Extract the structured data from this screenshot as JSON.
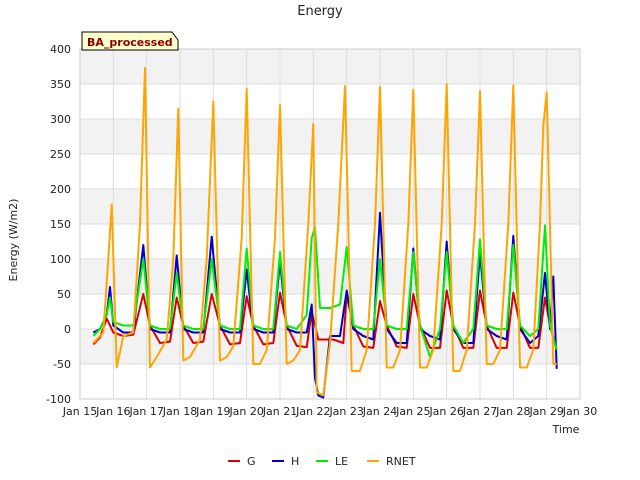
{
  "chart_data": {
    "type": "line",
    "title": "Energy",
    "xlabel": "Time",
    "ylabel": "Energy (W/m2)",
    "badge": "BA_processed",
    "xlim": [
      15,
      30
    ],
    "ylim": [
      -100,
      400
    ],
    "yticks": [
      -100,
      -50,
      0,
      50,
      100,
      150,
      200,
      250,
      300,
      350,
      400
    ],
    "xticks": [
      {
        "v": 15,
        "label": "Jan 15"
      },
      {
        "v": 16,
        "label": "Jan 16"
      },
      {
        "v": 17,
        "label": "Jan 17"
      },
      {
        "v": 18,
        "label": "Jan 18"
      },
      {
        "v": 19,
        "label": "Jan 19"
      },
      {
        "v": 20,
        "label": "Jan 20"
      },
      {
        "v": 21,
        "label": "Jan 21"
      },
      {
        "v": 22,
        "label": "Jan 22"
      },
      {
        "v": 23,
        "label": "Jan 23"
      },
      {
        "v": 24,
        "label": "Jan 24"
      },
      {
        "v": 25,
        "label": "Jan 25"
      },
      {
        "v": 26,
        "label": "Jan 26"
      },
      {
        "v": 27,
        "label": "Jan 27"
      },
      {
        "v": 28,
        "label": "Jan 28"
      },
      {
        "v": 29,
        "label": "Jan 29"
      },
      {
        "v": 30,
        "label": "Jan 30"
      }
    ],
    "grid": true,
    "legend_position": "bottom",
    "x_units": "day of January (fractional)",
    "series": [
      {
        "name": "G",
        "color": "#dd0000",
        "points": [
          [
            15.4,
            -22
          ],
          [
            15.6,
            -12
          ],
          [
            15.8,
            15
          ],
          [
            16.0,
            -5
          ],
          [
            16.3,
            -10
          ],
          [
            16.6,
            -8
          ],
          [
            16.9,
            50
          ],
          [
            17.1,
            5
          ],
          [
            17.4,
            -20
          ],
          [
            17.7,
            -18
          ],
          [
            17.9,
            45
          ],
          [
            18.1,
            5
          ],
          [
            18.4,
            -20
          ],
          [
            18.7,
            -18
          ],
          [
            18.95,
            50
          ],
          [
            19.2,
            5
          ],
          [
            19.5,
            -22
          ],
          [
            19.8,
            -20
          ],
          [
            20.0,
            47
          ],
          [
            20.2,
            5
          ],
          [
            20.5,
            -22
          ],
          [
            20.8,
            -20
          ],
          [
            21.0,
            52
          ],
          [
            21.2,
            5
          ],
          [
            21.5,
            -24
          ],
          [
            21.8,
            -26
          ],
          [
            21.95,
            25
          ],
          [
            22.15,
            -15
          ],
          [
            22.4,
            -15
          ],
          [
            22.6,
            -15
          ],
          [
            22.9,
            -20
          ],
          [
            23.0,
            48
          ],
          [
            23.2,
            5
          ],
          [
            23.5,
            -25
          ],
          [
            23.8,
            -27
          ],
          [
            24.0,
            40
          ],
          [
            24.2,
            5
          ],
          [
            24.5,
            -25
          ],
          [
            24.8,
            -27
          ],
          [
            25.0,
            50
          ],
          [
            25.2,
            5
          ],
          [
            25.5,
            -27
          ],
          [
            25.8,
            -27
          ],
          [
            26.0,
            55
          ],
          [
            26.2,
            5
          ],
          [
            26.5,
            -27
          ],
          [
            26.8,
            -27
          ],
          [
            27.0,
            55
          ],
          [
            27.2,
            5
          ],
          [
            27.5,
            -27
          ],
          [
            27.8,
            -27
          ],
          [
            28.0,
            52
          ],
          [
            28.2,
            5
          ],
          [
            28.5,
            -27
          ],
          [
            28.75,
            -27
          ],
          [
            28.95,
            45
          ],
          [
            29.1,
            5
          ],
          [
            29.3,
            -30
          ]
        ]
      },
      {
        "name": "H",
        "color": "#0000cc",
        "points": [
          [
            15.4,
            -5
          ],
          [
            15.6,
            0
          ],
          [
            15.8,
            20
          ],
          [
            15.9,
            60
          ],
          [
            16.0,
            5
          ],
          [
            16.3,
            -5
          ],
          [
            16.6,
            -5
          ],
          [
            16.9,
            120
          ],
          [
            17.1,
            0
          ],
          [
            17.4,
            -5
          ],
          [
            17.7,
            -5
          ],
          [
            17.9,
            105
          ],
          [
            18.1,
            0
          ],
          [
            18.4,
            -5
          ],
          [
            18.7,
            -5
          ],
          [
            18.95,
            132
          ],
          [
            19.2,
            0
          ],
          [
            19.5,
            -5
          ],
          [
            19.8,
            -5
          ],
          [
            20.0,
            85
          ],
          [
            20.2,
            0
          ],
          [
            20.5,
            -5
          ],
          [
            20.8,
            -5
          ],
          [
            21.0,
            98
          ],
          [
            21.2,
            0
          ],
          [
            21.5,
            -5
          ],
          [
            21.8,
            -5
          ],
          [
            21.95,
            35
          ],
          [
            22.05,
            -70
          ],
          [
            22.15,
            -95
          ],
          [
            22.3,
            -98
          ],
          [
            22.5,
            -10
          ],
          [
            22.8,
            -10
          ],
          [
            23.0,
            55
          ],
          [
            23.2,
            0
          ],
          [
            23.5,
            -10
          ],
          [
            23.8,
            -15
          ],
          [
            24.0,
            166
          ],
          [
            24.2,
            0
          ],
          [
            24.5,
            -20
          ],
          [
            24.8,
            -20
          ],
          [
            25.0,
            115
          ],
          [
            25.2,
            0
          ],
          [
            25.5,
            -10
          ],
          [
            25.8,
            -15
          ],
          [
            26.0,
            125
          ],
          [
            26.2,
            0
          ],
          [
            26.5,
            -20
          ],
          [
            26.8,
            -20
          ],
          [
            27.0,
            110
          ],
          [
            27.2,
            0
          ],
          [
            27.5,
            -10
          ],
          [
            27.8,
            -15
          ],
          [
            28.0,
            133
          ],
          [
            28.2,
            0
          ],
          [
            28.5,
            -20
          ],
          [
            28.75,
            -10
          ],
          [
            28.95,
            80
          ],
          [
            29.1,
            0
          ],
          [
            29.2,
            75
          ],
          [
            29.3,
            -57
          ]
        ]
      },
      {
        "name": "LE",
        "color": "#00ee00",
        "points": [
          [
            15.4,
            -10
          ],
          [
            15.6,
            0
          ],
          [
            15.8,
            20
          ],
          [
            15.9,
            45
          ],
          [
            16.0,
            10
          ],
          [
            16.3,
            5
          ],
          [
            16.6,
            5
          ],
          [
            16.9,
            100
          ],
          [
            17.1,
            5
          ],
          [
            17.4,
            0
          ],
          [
            17.7,
            0
          ],
          [
            17.9,
            80
          ],
          [
            18.1,
            5
          ],
          [
            18.4,
            0
          ],
          [
            18.7,
            0
          ],
          [
            18.95,
            100
          ],
          [
            19.2,
            5
          ],
          [
            19.5,
            0
          ],
          [
            19.8,
            0
          ],
          [
            20.0,
            115
          ],
          [
            20.2,
            5
          ],
          [
            20.5,
            0
          ],
          [
            20.8,
            0
          ],
          [
            21.0,
            110
          ],
          [
            21.2,
            5
          ],
          [
            21.5,
            0
          ],
          [
            21.8,
            20
          ],
          [
            21.95,
            130
          ],
          [
            22.05,
            145
          ],
          [
            22.2,
            30
          ],
          [
            22.5,
            30
          ],
          [
            22.8,
            35
          ],
          [
            23.0,
            117
          ],
          [
            23.2,
            5
          ],
          [
            23.5,
            0
          ],
          [
            23.8,
            0
          ],
          [
            24.0,
            100
          ],
          [
            24.2,
            5
          ],
          [
            24.5,
            0
          ],
          [
            24.8,
            0
          ],
          [
            25.0,
            110
          ],
          [
            25.2,
            5
          ],
          [
            25.5,
            -40
          ],
          [
            25.8,
            0
          ],
          [
            26.0,
            110
          ],
          [
            26.2,
            5
          ],
          [
            26.5,
            -20
          ],
          [
            26.8,
            0
          ],
          [
            27.0,
            128
          ],
          [
            27.2,
            5
          ],
          [
            27.5,
            0
          ],
          [
            27.8,
            0
          ],
          [
            28.0,
            120
          ],
          [
            28.2,
            5
          ],
          [
            28.5,
            -10
          ],
          [
            28.75,
            0
          ],
          [
            28.95,
            148
          ],
          [
            29.1,
            5
          ],
          [
            29.3,
            -30
          ]
        ]
      },
      {
        "name": "RNET",
        "color": "#ffa500",
        "points": [
          [
            15.4,
            -20
          ],
          [
            15.7,
            -5
          ],
          [
            15.85,
            100
          ],
          [
            15.95,
            178
          ],
          [
            16.1,
            -55
          ],
          [
            16.3,
            -10
          ],
          [
            16.6,
            -5
          ],
          [
            16.8,
            150
          ],
          [
            16.95,
            373
          ],
          [
            17.1,
            -55
          ],
          [
            17.3,
            -40
          ],
          [
            17.6,
            -15
          ],
          [
            17.8,
            100
          ],
          [
            17.95,
            315
          ],
          [
            18.1,
            -45
          ],
          [
            18.3,
            -40
          ],
          [
            18.6,
            -15
          ],
          [
            18.8,
            100
          ],
          [
            19.0,
            325
          ],
          [
            19.2,
            -45
          ],
          [
            19.4,
            -40
          ],
          [
            19.6,
            -25
          ],
          [
            19.85,
            130
          ],
          [
            20.0,
            343
          ],
          [
            20.2,
            -50
          ],
          [
            20.4,
            -50
          ],
          [
            20.6,
            -30
          ],
          [
            20.85,
            130
          ],
          [
            21.0,
            320
          ],
          [
            21.2,
            -50
          ],
          [
            21.4,
            -45
          ],
          [
            21.6,
            -30
          ],
          [
            21.85,
            150
          ],
          [
            22.0,
            293
          ],
          [
            22.1,
            -90
          ],
          [
            22.3,
            -95
          ],
          [
            22.5,
            -20
          ],
          [
            22.75,
            150
          ],
          [
            22.95,
            347
          ],
          [
            23.15,
            -60
          ],
          [
            23.4,
            -60
          ],
          [
            23.6,
            -30
          ],
          [
            23.85,
            150
          ],
          [
            24.0,
            346
          ],
          [
            24.2,
            -55
          ],
          [
            24.4,
            -55
          ],
          [
            24.6,
            -30
          ],
          [
            24.85,
            150
          ],
          [
            25.0,
            342
          ],
          [
            25.2,
            -55
          ],
          [
            25.4,
            -55
          ],
          [
            25.6,
            -30
          ],
          [
            25.85,
            150
          ],
          [
            26.0,
            350
          ],
          [
            26.2,
            -60
          ],
          [
            26.4,
            -60
          ],
          [
            26.6,
            -30
          ],
          [
            26.85,
            150
          ],
          [
            27.0,
            340
          ],
          [
            27.2,
            -50
          ],
          [
            27.4,
            -50
          ],
          [
            27.6,
            -30
          ],
          [
            27.85,
            150
          ],
          [
            28.0,
            348
          ],
          [
            28.2,
            -55
          ],
          [
            28.4,
            -55
          ],
          [
            28.6,
            -30
          ],
          [
            28.8,
            150
          ],
          [
            28.9,
            290
          ],
          [
            29.0,
            338
          ],
          [
            29.2,
            -50
          ],
          [
            29.3,
            -50
          ]
        ]
      }
    ]
  }
}
